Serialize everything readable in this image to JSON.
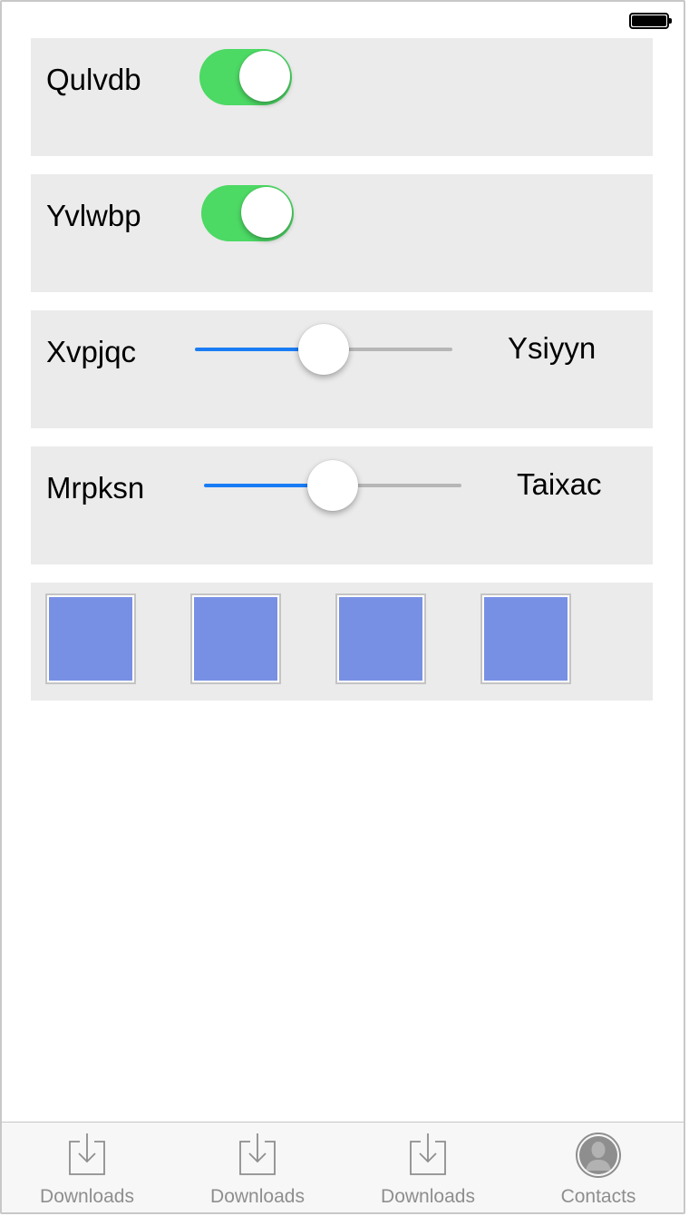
{
  "colors": {
    "toggle_on": "#4cd964",
    "slider_min_track": "#1a7cf5",
    "slider_max_track": "#b6b6b6",
    "swatch_fill": "#7890e4",
    "tab_inactive": "#8e8e8e"
  },
  "rows": {
    "toggle1": {
      "label": "Qulvdb",
      "on": true
    },
    "toggle2": {
      "label": "Yvlwbp",
      "on": true
    },
    "slider1": {
      "min_label": "Xvpjqc",
      "max_label": "Ysiyyn",
      "value": 0.5
    },
    "slider2": {
      "min_label": "Mrpksn",
      "max_label": "Taixac",
      "value": 0.5
    },
    "swatches": {
      "count": 4,
      "color": "#7890e4"
    }
  },
  "tab_bar": {
    "items": [
      {
        "label": "Downloads",
        "icon": "download-icon"
      },
      {
        "label": "Downloads",
        "icon": "download-icon"
      },
      {
        "label": "Downloads",
        "icon": "download-icon"
      },
      {
        "label": "Contacts",
        "icon": "contact-icon"
      }
    ]
  }
}
